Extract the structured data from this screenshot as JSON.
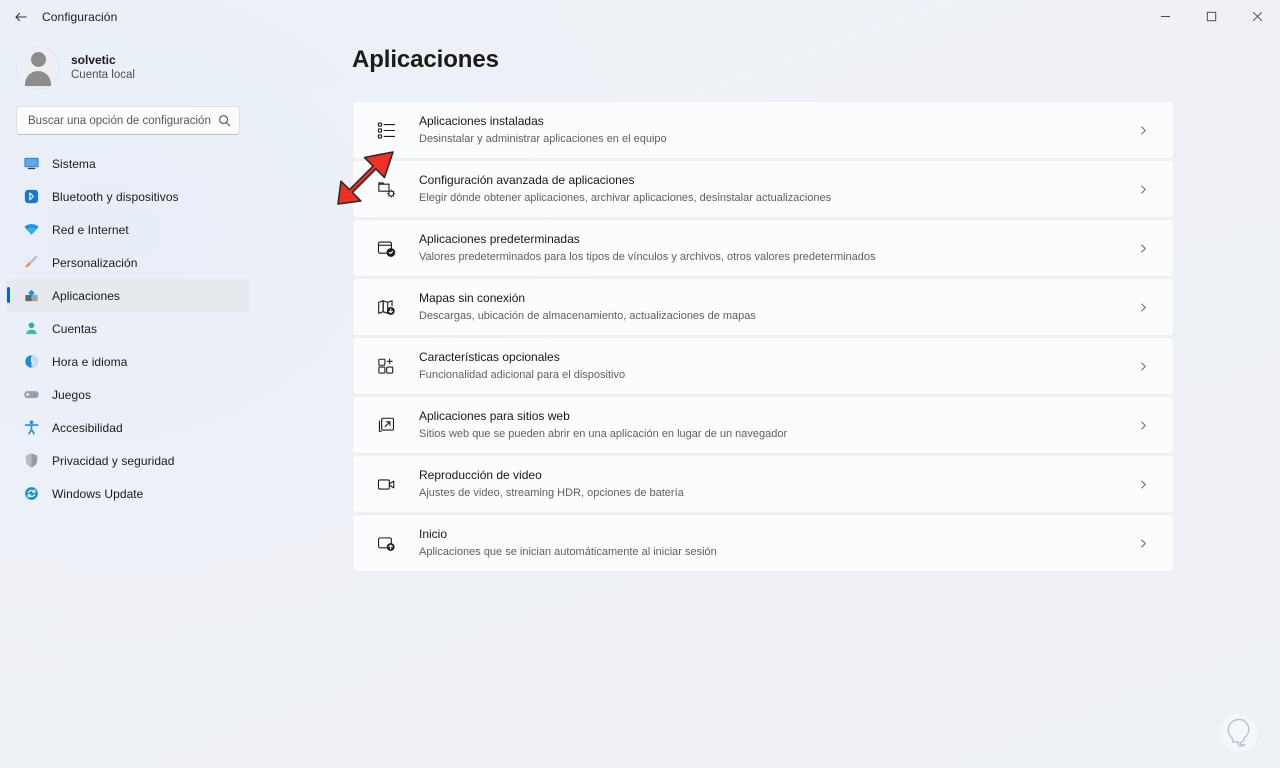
{
  "window": {
    "title": "Configuración",
    "back_icon": "back-arrow-icon",
    "controls": {
      "minimize": "minimize-icon",
      "maximize": "maximize-icon",
      "close": "close-icon"
    }
  },
  "sidebar": {
    "account": {
      "name": "solvetic",
      "subtitle": "Cuenta local",
      "avatar_icon": "avatar-person-icon"
    },
    "search": {
      "placeholder": "Buscar una opción de configuración",
      "value": "",
      "icon": "search-icon"
    },
    "items": [
      {
        "label": "Sistema",
        "icon": "system-monitor-icon",
        "selected": false
      },
      {
        "label": "Bluetooth y dispositivos",
        "icon": "bluetooth-icon",
        "selected": false
      },
      {
        "label": "Red e Internet",
        "icon": "network-wifi-icon",
        "selected": false
      },
      {
        "label": "Personalización",
        "icon": "personalization-brush-icon",
        "selected": false
      },
      {
        "label": "Aplicaciones",
        "icon": "apps-blocks-icon",
        "selected": true
      },
      {
        "label": "Cuentas",
        "icon": "accounts-person-icon",
        "selected": false
      },
      {
        "label": "Hora e idioma",
        "icon": "time-language-clock-icon",
        "selected": false
      },
      {
        "label": "Juegos",
        "icon": "gaming-controller-icon",
        "selected": false
      },
      {
        "label": "Accesibilidad",
        "icon": "accessibility-person-icon",
        "selected": false
      },
      {
        "label": "Privacidad y seguridad",
        "icon": "privacy-shield-icon",
        "selected": false
      },
      {
        "label": "Windows Update",
        "icon": "windows-update-refresh-icon",
        "selected": false
      }
    ]
  },
  "main": {
    "page_title": "Aplicaciones",
    "rows": [
      {
        "title": "Aplicaciones instaladas",
        "subtitle": "Desinstalar y administrar aplicaciones en el equipo",
        "icon": "installed-apps-list-icon",
        "chevron": "chevron-right-icon"
      },
      {
        "title": "Configuración avanzada de aplicaciones",
        "subtitle": "Elegir dónde obtener aplicaciones, archivar aplicaciones, desinstalar actualizaciones",
        "icon": "advanced-app-settings-gear-icon",
        "chevron": "chevron-right-icon"
      },
      {
        "title": "Aplicaciones predeterminadas",
        "subtitle": "Valores predeterminados para los tipos de vínculos y archivos, otros valores predeterminados",
        "icon": "default-apps-check-icon",
        "chevron": "chevron-right-icon"
      },
      {
        "title": "Mapas sin conexión",
        "subtitle": "Descargas, ubicación de almacenamiento, actualizaciones de mapas",
        "icon": "offline-maps-icon",
        "chevron": "chevron-right-icon"
      },
      {
        "title": "Características opcionales",
        "subtitle": "Funcionalidad adicional para el dispositivo",
        "icon": "optional-features-plus-icon",
        "chevron": "chevron-right-icon"
      },
      {
        "title": "Aplicaciones para sitios web",
        "subtitle": "Sitios web que se pueden abrir en una aplicación en lugar de un navegador",
        "icon": "apps-for-websites-icon",
        "chevron": "chevron-right-icon"
      },
      {
        "title": "Reproducción de video",
        "subtitle": "Ajustes de video, streaming HDR, opciones de batería",
        "icon": "video-playback-camera-icon",
        "chevron": "chevron-right-icon"
      },
      {
        "title": "Inicio",
        "subtitle": "Aplicaciones que se inician automáticamente al iniciar sesión",
        "icon": "startup-apps-icon",
        "chevron": "chevron-right-icon"
      }
    ]
  },
  "annotation": {
    "arrow": "red-pointer-arrow",
    "color": "#ee3124",
    "target_row_index": 1
  },
  "watermark": {
    "icon": "solvetic-lightbulb-logo"
  },
  "colors": {
    "accent": "#0b63c5",
    "background": "#eef1f6",
    "card": "#fbfcfd",
    "annotation_red": "#ee3124"
  }
}
